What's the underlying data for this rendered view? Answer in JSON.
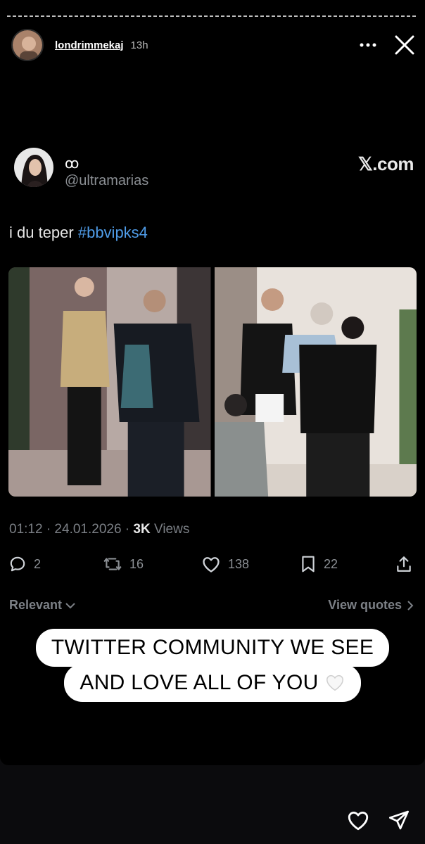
{
  "story": {
    "username": "londrimmekaj",
    "time": "13h"
  },
  "tweet": {
    "display_name": "ꝏ",
    "handle": "@ultramarias",
    "brand": "𝕏.com",
    "text_prefix": "i du teper ",
    "hashtag": "#bbvipks4",
    "meta": {
      "datetime": "01:12 · 24.01.2026 · ",
      "views_count": "3K",
      "views_label": " Views"
    },
    "actions": {
      "replies": "2",
      "reposts": "16",
      "likes": "138",
      "bookmarks": "22"
    },
    "sort_label": "Relevant",
    "quotes_label": "View quotes"
  },
  "caption": {
    "line1": "TWITTER COMMUNITY WE SEE",
    "line2": "AND LOVE ALL OF YOU"
  },
  "colors": {
    "hashtag": "#4f9ce8",
    "muted": "#7c8086",
    "background": "#000000"
  },
  "icons": [
    "more-icon",
    "close-icon",
    "reply-icon",
    "repost-icon",
    "like-icon",
    "bookmark-icon",
    "share-icon",
    "chevron-down-icon",
    "chevron-right-icon",
    "white-heart-icon",
    "heart-icon",
    "send-icon"
  ]
}
